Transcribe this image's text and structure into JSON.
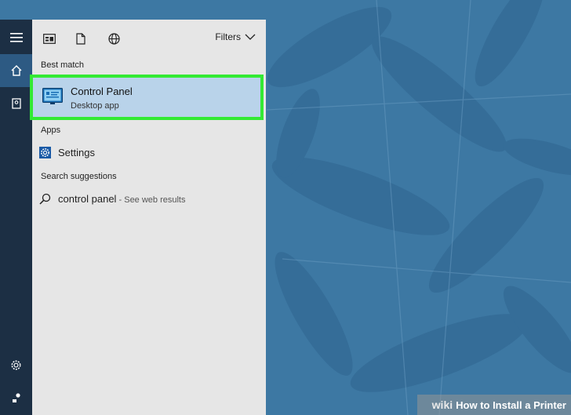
{
  "colors": {
    "desktop": "#3d78a3",
    "rail": "#1c2f44",
    "panel": "#e6e6e6",
    "highlight": "#b9d3ea",
    "highlight_border": "#33ea33"
  },
  "rail": {
    "icons": [
      "hamburger-icon",
      "home-icon",
      "notebook-icon",
      "gear-icon",
      "feedback-icon"
    ]
  },
  "toolbar": {
    "icons": [
      "apps-icon",
      "document-icon",
      "globe-icon"
    ],
    "filters_label": "Filters"
  },
  "sections": {
    "best_match": "Best match",
    "apps": "Apps",
    "search_suggestions": "Search suggestions"
  },
  "best_match": {
    "title": "Control Panel",
    "subtitle": "Desktop app",
    "icon": "control-panel-icon"
  },
  "apps": {
    "items": [
      {
        "label": "Settings",
        "icon": "settings-icon"
      }
    ]
  },
  "suggestions": {
    "items": [
      {
        "query": "control panel",
        "hint": " - See web results",
        "icon": "search-icon"
      }
    ]
  },
  "watermark": {
    "brand": "wiki",
    "text": "How to Install a Printer"
  }
}
